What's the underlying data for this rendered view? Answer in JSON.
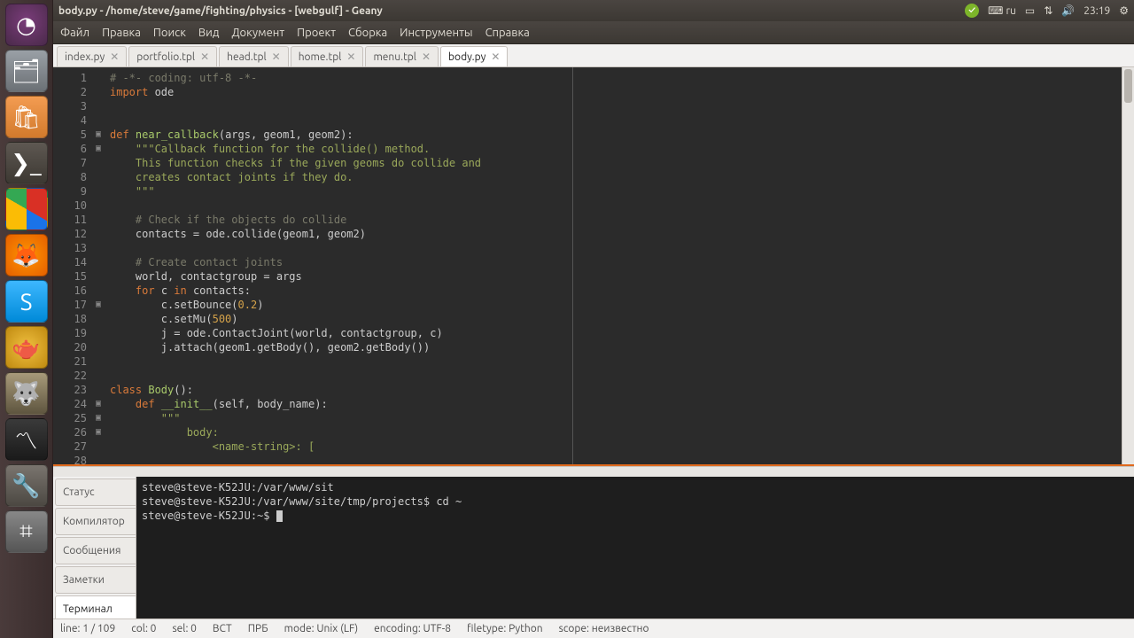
{
  "panel": {
    "title": "body.py - /home/steve/game/fighting/physics - [webgulf] - Geany",
    "kb_layout": "ru",
    "time": "23:19"
  },
  "menubar": [
    "Файл",
    "Правка",
    "Поиск",
    "Вид",
    "Документ",
    "Проект",
    "Сборка",
    "Инструменты",
    "Справка"
  ],
  "tabs": [
    {
      "label": "index.py",
      "active": false
    },
    {
      "label": "portfolio.tpl",
      "active": false
    },
    {
      "label": "head.tpl",
      "active": false
    },
    {
      "label": "home.tpl",
      "active": false
    },
    {
      "label": "menu.tpl",
      "active": false
    },
    {
      "label": "body.py",
      "active": true
    }
  ],
  "code_lines": [
    {
      "n": 1,
      "fold": "",
      "html": "<span class='tok-cm'># -*- coding: utf-8 -*-</span>"
    },
    {
      "n": 2,
      "fold": "",
      "html": "<span class='tok-kw'>import</span> ode"
    },
    {
      "n": 3,
      "fold": "",
      "html": ""
    },
    {
      "n": 4,
      "fold": "",
      "html": ""
    },
    {
      "n": 5,
      "fold": "▣",
      "html": "<span class='tok-kw'>def</span> <span class='tok-fn'>near_callback</span>(args, geom1, geom2):"
    },
    {
      "n": 6,
      "fold": "▣",
      "html": "    <span class='tok-st'>\"\"\"Callback function for the collide() method.</span>"
    },
    {
      "n": 7,
      "fold": "",
      "html": "<span class='tok-st'></span>"
    },
    {
      "n": 8,
      "fold": "",
      "html": "<span class='tok-st'>    This function checks if the given geoms do collide and</span>"
    },
    {
      "n": 9,
      "fold": "",
      "html": "<span class='tok-st'>    creates contact joints if they do.</span>"
    },
    {
      "n": 10,
      "fold": "",
      "html": "<span class='tok-st'>    \"\"\"</span>"
    },
    {
      "n": 11,
      "fold": "",
      "html": ""
    },
    {
      "n": 12,
      "fold": "",
      "html": "    <span class='tok-cm'># Check if the objects do collide</span>"
    },
    {
      "n": 13,
      "fold": "",
      "html": "    contacts = ode.collide(geom1, geom2)"
    },
    {
      "n": 14,
      "fold": "",
      "html": ""
    },
    {
      "n": 15,
      "fold": "",
      "html": "    <span class='tok-cm'># Create contact joints</span>"
    },
    {
      "n": 16,
      "fold": "",
      "html": "    world, contactgroup = args"
    },
    {
      "n": 17,
      "fold": "▣",
      "html": "    <span class='tok-kw'>for</span> c <span class='tok-kw'>in</span> contacts:"
    },
    {
      "n": 18,
      "fold": "",
      "html": "        c.setBounce(<span class='tok-nm'>0.2</span>)"
    },
    {
      "n": 19,
      "fold": "",
      "html": "        c.setMu(<span class='tok-nm'>500</span>)"
    },
    {
      "n": 20,
      "fold": "",
      "html": "        j = ode.ContactJoint(world, contactgroup, c)"
    },
    {
      "n": 21,
      "fold": "",
      "html": "        j.attach(geom1.getBody(), geom2.getBody())"
    },
    {
      "n": 22,
      "fold": "",
      "html": ""
    },
    {
      "n": 23,
      "fold": "",
      "html": ""
    },
    {
      "n": 24,
      "fold": "▣",
      "html": "<span class='tok-kw'>class</span> <span class='tok-fn'>Body</span>():"
    },
    {
      "n": 25,
      "fold": "▣",
      "html": "    <span class='tok-kw'>def</span> <span class='tok-fn'>__init__</span>(self, body_name):"
    },
    {
      "n": 26,
      "fold": "▣",
      "html": "        <span class='tok-st'>\"\"\"</span>"
    },
    {
      "n": 27,
      "fold": "",
      "html": "<span class='tok-st'>            body:</span>"
    },
    {
      "n": 28,
      "fold": "",
      "html": "<span class='tok-st'>                &lt;name-string&gt;: [</span>"
    }
  ],
  "bottom_tabs": [
    {
      "label": "Статус",
      "active": false
    },
    {
      "label": "Компилятор",
      "active": false
    },
    {
      "label": "Сообщения",
      "active": false
    },
    {
      "label": "Заметки",
      "active": false
    },
    {
      "label": "Терминал",
      "active": true
    }
  ],
  "terminal_lines": [
    "steve@steve-K52JU:/var/www/sit",
    "steve@steve-K52JU:/var/www/site/tmp/projects$ cd ~",
    "steve@steve-K52JU:~$ "
  ],
  "statusbar": {
    "line": "line: 1 / 109",
    "col": "col: 0",
    "sel": "sel: 0",
    "ins": "ВСТ",
    "prb": "ПРБ",
    "mode": "mode: Unix (LF)",
    "enc": "encoding: UTF-8",
    "ft": "filetype: Python",
    "scope": "scope: неизвестно"
  }
}
